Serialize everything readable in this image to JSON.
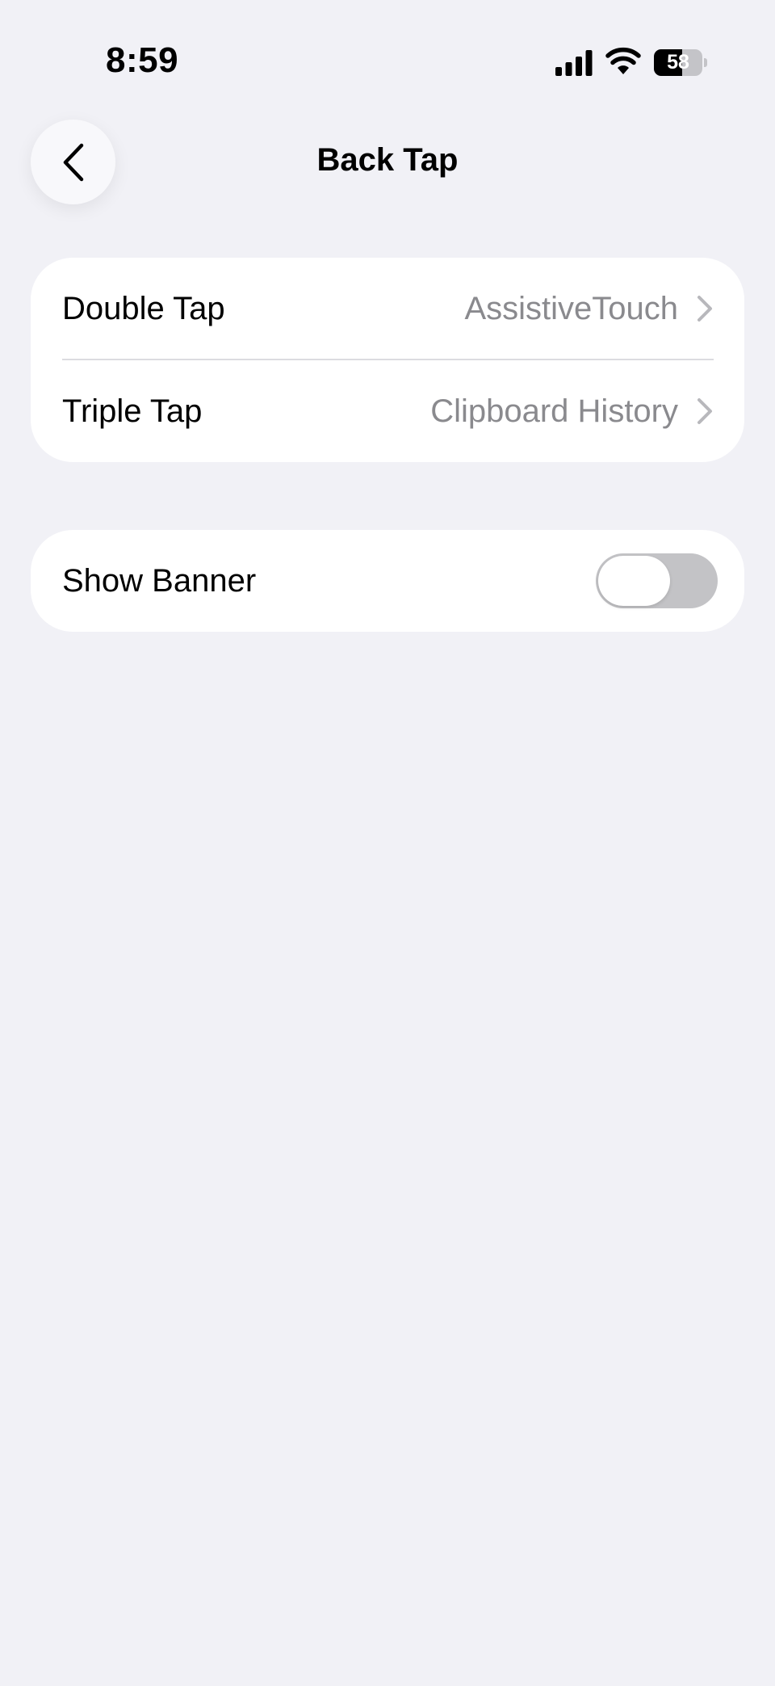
{
  "status_bar": {
    "time": "8:59",
    "battery_level": "58",
    "battery_fraction": 0.58,
    "icons": [
      "cellular-signal-icon",
      "wifi-icon",
      "battery-icon"
    ]
  },
  "header": {
    "title": "Back Tap",
    "back_icon": "chevron-left-icon"
  },
  "tap_actions": [
    {
      "label": "Double Tap",
      "value": "AssistiveTouch"
    },
    {
      "label": "Triple Tap",
      "value": "Clipboard History"
    }
  ],
  "banner": {
    "label": "Show Banner",
    "enabled": false
  },
  "colors": {
    "background": "#f1f1f6",
    "card": "#ffffff",
    "secondary_text": "#8a8a8e",
    "toggle_off": "#c3c3c6"
  }
}
